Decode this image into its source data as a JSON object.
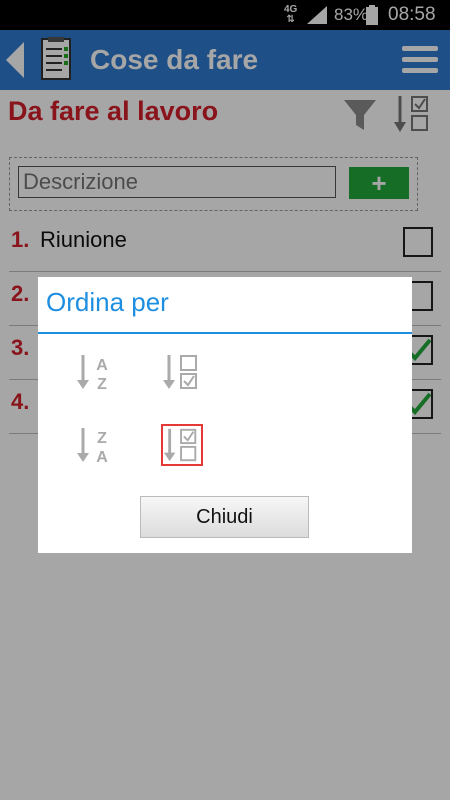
{
  "status": {
    "network": "4G",
    "battery": "83%",
    "time": "08:58"
  },
  "appbar": {
    "title": "Cose da fare"
  },
  "list": {
    "title": "Da fare al lavoro"
  },
  "add": {
    "placeholder": "Descrizione",
    "button_label": "+"
  },
  "items": [
    {
      "num": "1.",
      "text": "Riunione",
      "checked": false
    },
    {
      "num": "2.",
      "text": "",
      "checked": false
    },
    {
      "num": "3.",
      "text": "",
      "checked": true
    },
    {
      "num": "4.",
      "text": "",
      "checked": true
    }
  ],
  "dialog": {
    "title": "Ordina per",
    "options": [
      {
        "icon": "sort-alpha-asc-icon",
        "selected": false
      },
      {
        "icon": "sort-unchecked-first-icon",
        "selected": false
      },
      {
        "icon": "sort-alpha-desc-icon",
        "selected": false
      },
      {
        "icon": "sort-checked-first-icon",
        "selected": true
      }
    ],
    "close_label": "Chiudi"
  },
  "colors": {
    "appbar": "#2F7BD0",
    "accent_red": "#D3202A",
    "dialog_blue": "#1E8FE0",
    "check_green": "#22A83A"
  }
}
